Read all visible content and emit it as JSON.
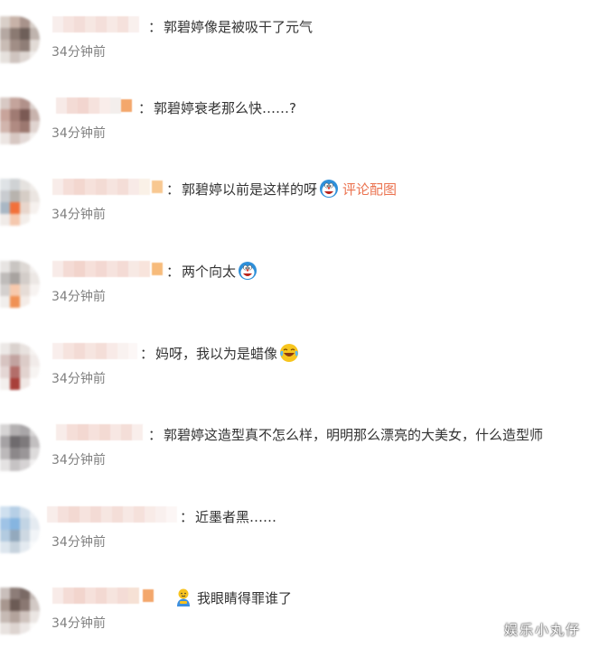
{
  "comments": [
    {
      "text": "郭碧婷像是被吸干了元气",
      "time": "34分钟前",
      "emoji": "",
      "image_link": ""
    },
    {
      "text": "郭碧婷衰老那么快……?",
      "time": "34分钟前",
      "emoji": "",
      "image_link": ""
    },
    {
      "text": "郭碧婷以前是这样的呀",
      "time": "34分钟前",
      "emoji": "doraemon-face",
      "image_link": "评论配图"
    },
    {
      "text": "两个向太",
      "time": "34分钟前",
      "emoji": "doraemon-face",
      "image_link": ""
    },
    {
      "text": "妈呀，我以为是蜡像",
      "time": "34分钟前",
      "emoji": "laughing-crying-face",
      "image_link": ""
    },
    {
      "text": "郭碧婷这造型真不怎么样，明明那么漂亮的大美女，什么造型师",
      "time": "34分钟前",
      "emoji": "",
      "image_link": ""
    },
    {
      "text": "近墨者黑……",
      "time": "34分钟前",
      "emoji": "",
      "image_link": ""
    },
    {
      "text": "我眼睛得罪谁了",
      "time": "34分钟前",
      "emoji": "blue-figure-emoji",
      "image_link": ""
    }
  ],
  "watermark": "娱乐小丸仔",
  "colors": {
    "text": "#333333",
    "time": "#808080",
    "link": "#eb7350",
    "badge": "#f08a3c"
  }
}
